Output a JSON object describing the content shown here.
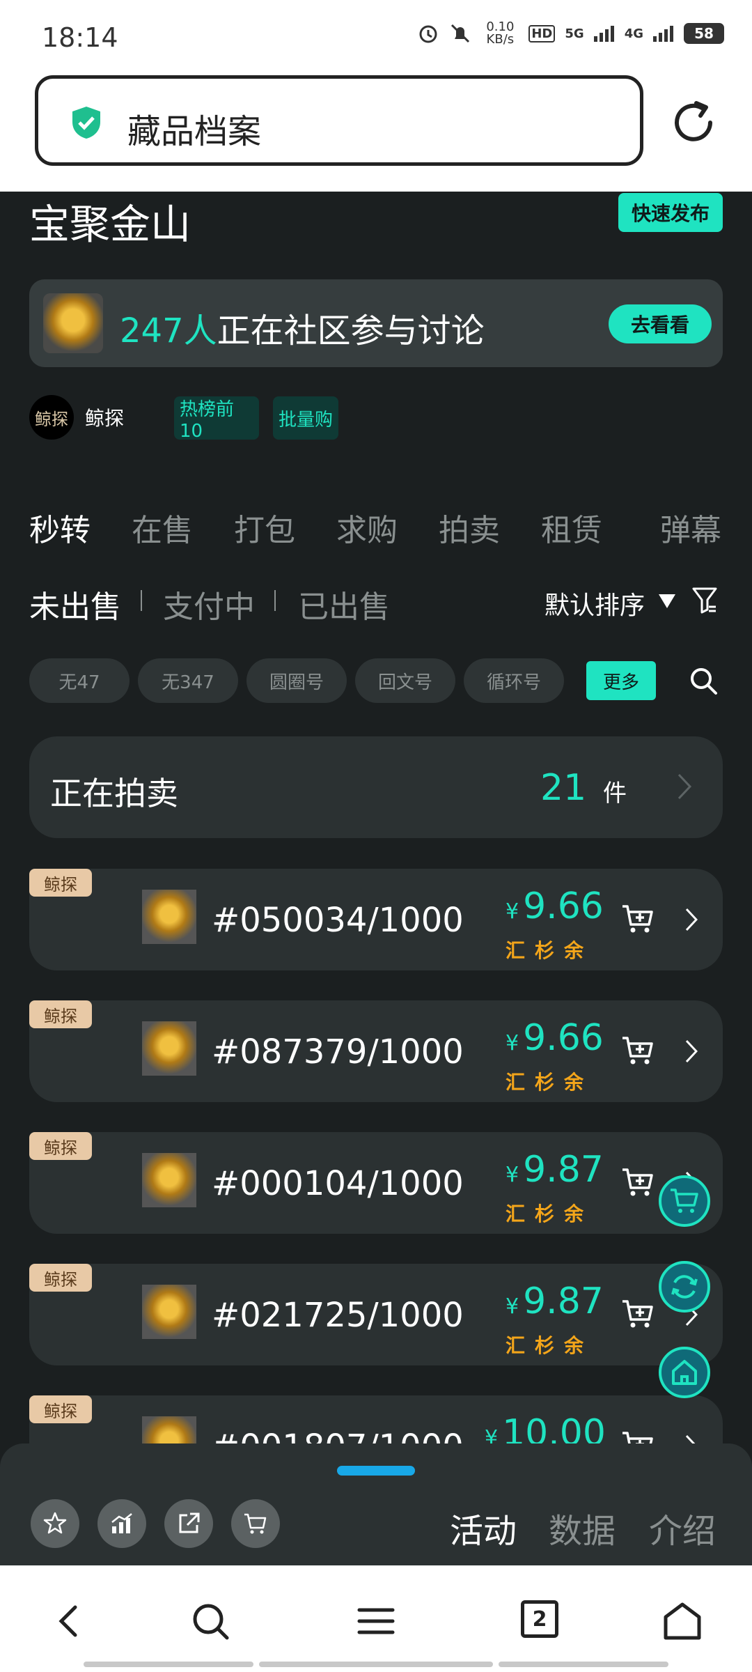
{
  "status": {
    "time": "18:14",
    "net_speed": "0.10 KB/s",
    "hd": "HD",
    "sim1": "5G",
    "sim2": "4G",
    "battery": "58"
  },
  "browser": {
    "title": "藏品档案"
  },
  "collection": {
    "name": "宝聚金山",
    "publish_label": "快速发布"
  },
  "community": {
    "count": "247人",
    "text": "正在社区参与讨论",
    "button": "去看看"
  },
  "creator": {
    "avatar_text": "鲸探",
    "name": "鲸探"
  },
  "tags": [
    "热榜前10",
    "批量购"
  ],
  "tabs": [
    "秒转",
    "在售",
    "打包",
    "求购",
    "拍卖",
    "租赁",
    "弹幕"
  ],
  "subtabs": [
    "未出售",
    "支付中",
    "已出售"
  ],
  "sort_label": "默认排序",
  "chips": [
    "无47",
    "无347",
    "圆圈号",
    "回文号",
    "循环号"
  ],
  "chips_more": "更多",
  "auction": {
    "label": "正在拍卖",
    "count": "21",
    "unit": "件"
  },
  "items": [
    {
      "badge": "鲸探",
      "serial": "#050034/1000",
      "currency": "¥",
      "price": "9.66",
      "source": "汇杉余"
    },
    {
      "badge": "鲸探",
      "serial": "#087379/1000",
      "currency": "¥",
      "price": "9.66",
      "source": "汇杉余"
    },
    {
      "badge": "鲸探",
      "serial": "#000104/1000",
      "currency": "¥",
      "price": "9.87",
      "source": "汇杉余"
    },
    {
      "badge": "鲸探",
      "serial": "#021725/1000",
      "currency": "¥",
      "price": "9.87",
      "source": "汇杉余"
    },
    {
      "badge": "鲸探",
      "serial": "#001807/1000",
      "currency": "¥",
      "price": "10.00",
      "source": ""
    }
  ],
  "sheet_tabs": [
    "活动",
    "数据",
    "介绍"
  ],
  "nav": {
    "tabs_count": "2"
  },
  "colors": {
    "accent": "#1fe3c1",
    "background": "#1b1f20",
    "card": "#2b3132",
    "price_source": "#f3a51a",
    "badge": "#e8c9a6"
  }
}
